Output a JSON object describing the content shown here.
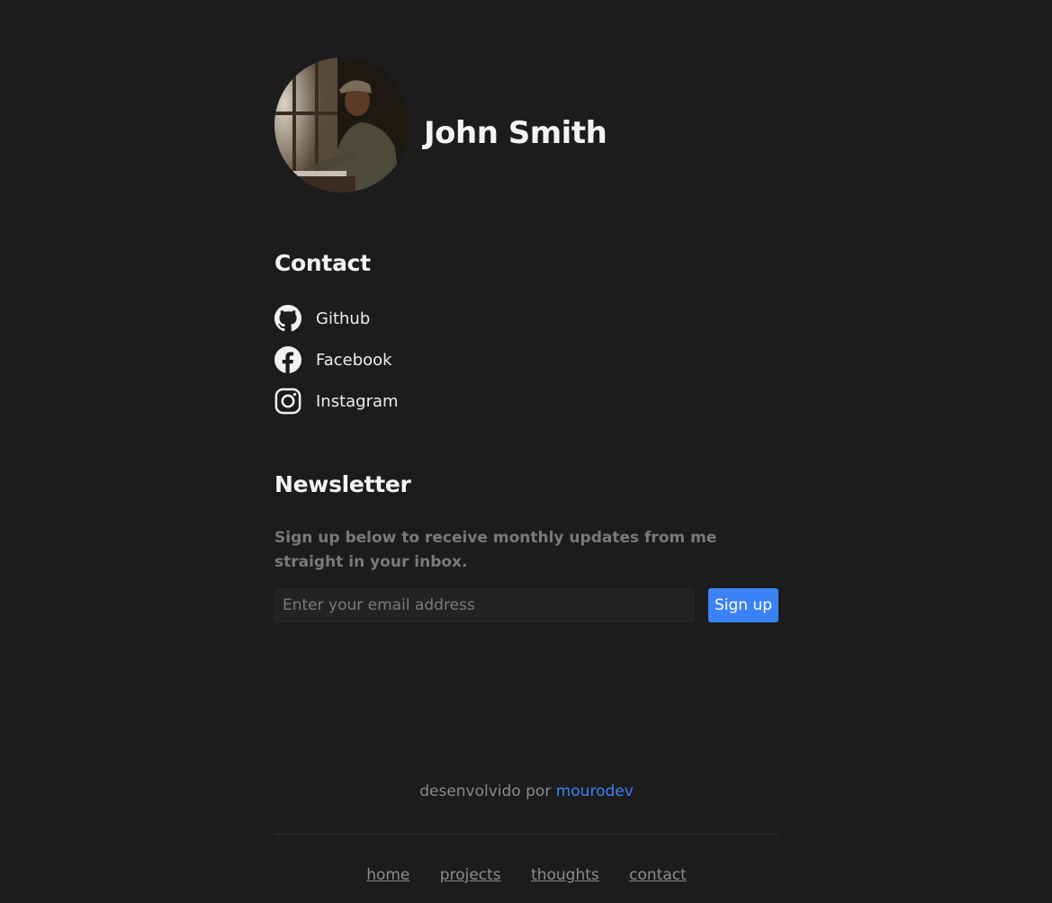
{
  "profile": {
    "name": "John Smith",
    "avatar_icon": "avatar-photo"
  },
  "contact": {
    "heading": "Contact",
    "items": [
      {
        "label": "Github",
        "icon": "github-icon"
      },
      {
        "label": "Facebook",
        "icon": "facebook-icon"
      },
      {
        "label": "Instagram",
        "icon": "instagram-icon"
      }
    ]
  },
  "newsletter": {
    "heading": "Newsletter",
    "description": "Sign up below to receive monthly updates from me straight in your inbox.",
    "email_placeholder": "Enter your email address",
    "signup_label": "Sign up"
  },
  "footer": {
    "credit_prefix": "desenvolvido por",
    "credit_link": "mourodev",
    "nav": [
      "home",
      "projects",
      "thoughts",
      "contact"
    ]
  },
  "colors": {
    "background": "#1c1c1d",
    "accent": "#3b82f6",
    "muted_text": "#7a7a7a"
  }
}
